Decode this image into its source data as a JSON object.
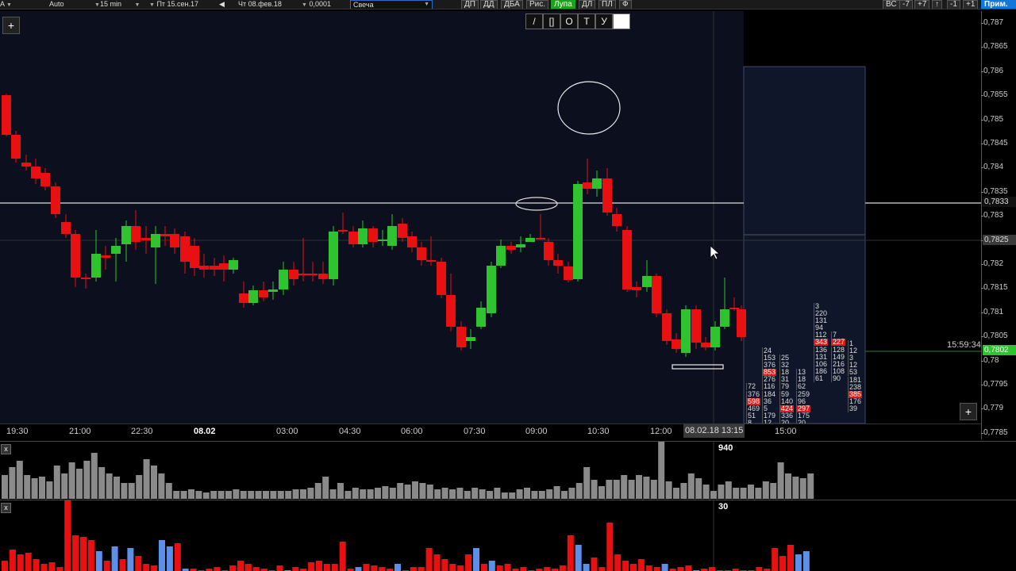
{
  "toolbar": {
    "instrument": "A",
    "mode": "Auto",
    "timeframe": "15 min",
    "date_from": "Пт 15.сен.17",
    "date_to": "Чт 08.фев.18",
    "tick": "0,0001",
    "chart_type": "Свеча",
    "buttons": [
      "ДП",
      "ДД",
      "ДБА",
      "Рис.",
      "Лупа",
      "ДЛ",
      "ПЛ",
      "Ф"
    ],
    "active_button": "Лупа",
    "right_buttons": [
      "ВС",
      "-7",
      "+7",
      "↑",
      "-1",
      "+1"
    ],
    "apply_label": "Прим."
  },
  "draw_tools": [
    "/",
    "[]",
    "O",
    "T",
    "У",
    ""
  ],
  "main_chart": {
    "y_ticks": [
      "0,787",
      "0,7865",
      "0,786",
      "0,7855",
      "0,785",
      "0,7845",
      "0,784",
      "0,7835",
      "0,783",
      "0,7825",
      "0,782",
      "0,7815",
      "0,781",
      "0,7805",
      "0,78",
      "0,7795",
      "0,779",
      "0,7785"
    ],
    "x_ticks": [
      "19:30",
      "21:00",
      "22:30",
      "08.02",
      "03:00",
      "04:30",
      "06:00",
      "07:30",
      "09:00",
      "10:30",
      "12:00",
      "15:00"
    ],
    "cursor_time": "08.02.18 13:15",
    "hline_price": "0,7833",
    "cursor_price": "0,7825",
    "last_price": "0,7802",
    "last_time": "15:59:34",
    "colors": {
      "up": "#2fc42f",
      "down": "#e81010",
      "background": "#000000",
      "box": "#10162a"
    }
  },
  "cluster": {
    "columns": [
      [
        "72",
        "376",
        "598",
        "469",
        "51",
        "8"
      ],
      [
        "24",
        "153",
        "376",
        "853",
        "276",
        "116",
        "184",
        "36",
        "5",
        "179",
        "12"
      ],
      [
        "25",
        "32",
        "18",
        "31",
        "79",
        "59",
        "140",
        "424",
        "336",
        "20"
      ],
      [
        "13",
        "18",
        "62",
        "259",
        "96",
        "297",
        "175",
        "20"
      ],
      [
        "3",
        "220",
        "131",
        "94",
        "112",
        "343",
        "136",
        "131",
        "106",
        "186",
        "61"
      ],
      [
        "7",
        "227",
        "128",
        "149",
        "216",
        "108",
        "90"
      ],
      [
        "1",
        "12",
        "3",
        "12",
        "53",
        "181",
        "238",
        "385",
        "176",
        "39"
      ]
    ]
  },
  "volume_panel": {
    "max_label": "940"
  },
  "delta_panel": {
    "max_label": "30",
    "colors": {
      "sell": "#e81010",
      "buy": "#5b8fe8"
    }
  }
}
